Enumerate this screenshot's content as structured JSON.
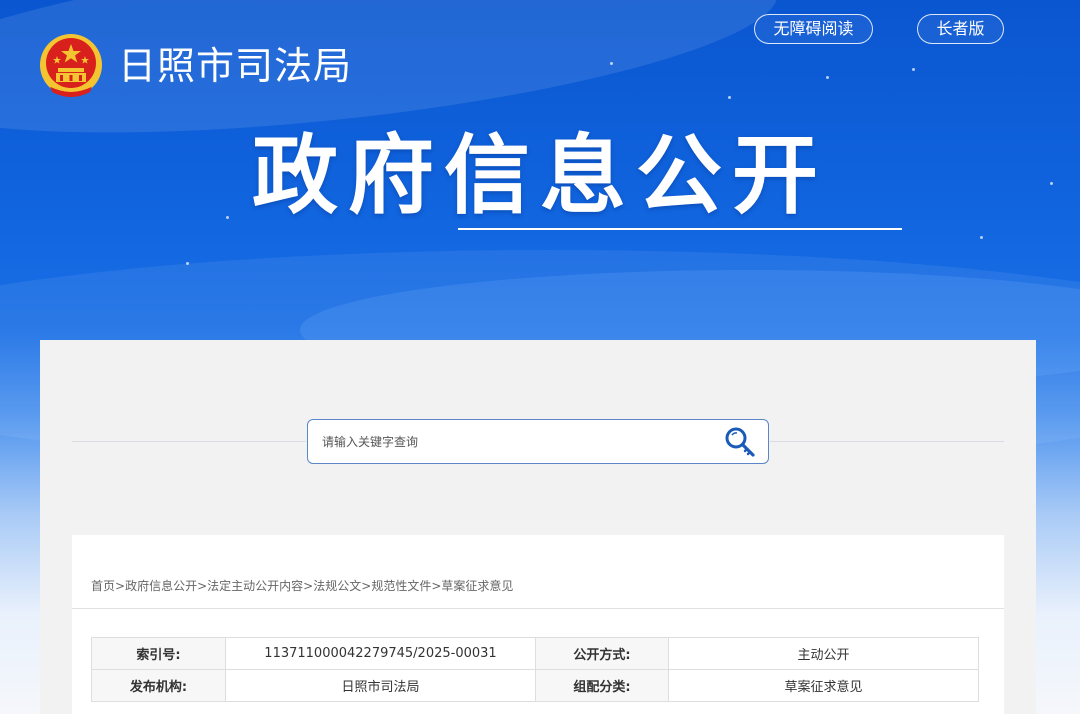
{
  "header": {
    "site_title": "日照市司法局",
    "banner_title": "政府信息公开",
    "buttons": {
      "accessibility": "无障碍阅读",
      "elder": "长者版"
    }
  },
  "search": {
    "placeholder": "请输入关键字查询"
  },
  "breadcrumb": [
    "首页",
    "政府信息公开",
    "法定主动公开内容",
    "法规公文",
    "规范性文件",
    "草案征求意见"
  ],
  "breadcrumb_separator": ">",
  "meta_table": {
    "rows": [
      [
        {
          "label": "索引号:",
          "value": "113711000042279745/2025-00031"
        },
        {
          "label": "公开方式:",
          "value": "主动公开"
        }
      ],
      [
        {
          "label": "发布机构:",
          "value": "日照市司法局"
        },
        {
          "label": "组配分类:",
          "value": "草案征求意见"
        }
      ]
    ]
  },
  "colors": {
    "banner_blue": "#0a56d0",
    "emblem_red": "#d8201c",
    "emblem_gold": "#f4c531",
    "search_border": "#5b86c8",
    "search_icon": "#1a5bb8"
  },
  "icons": {
    "emblem": "national-emblem-icon",
    "search": "search-key-icon"
  }
}
